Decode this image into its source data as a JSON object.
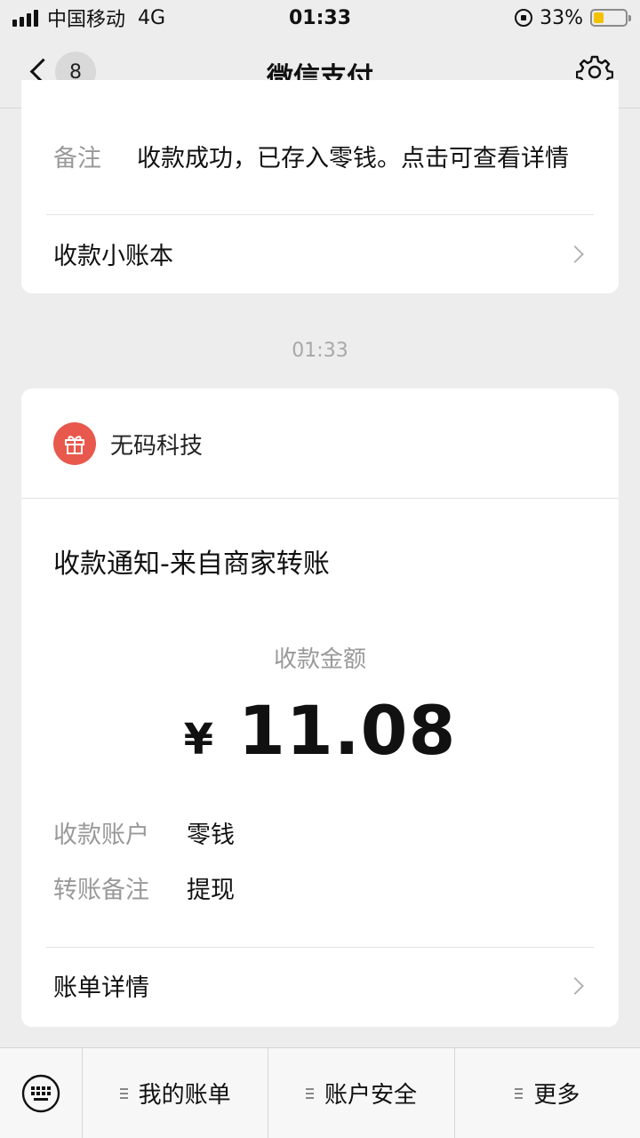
{
  "status_bar": {
    "carrier": "中国移动",
    "network": "4G",
    "time": "01:33",
    "battery": "33%",
    "battery_level": 0.33
  },
  "nav": {
    "badge": "8",
    "title": "微信支付"
  },
  "prev_card": {
    "remark_label": "备注",
    "remark_value": "收款成功，已存入零钱。点击可查看详情",
    "ledger_link": "收款小账本"
  },
  "message_time": "01:33",
  "notice": {
    "merchant": "无码科技",
    "title": "收款通知-来自商家转账",
    "amount_label": "收款金额",
    "currency": "¥",
    "amount": "11.08",
    "account_label": "收款账户",
    "account_value": "零钱",
    "note_label": "转账备注",
    "note_value": "提现",
    "details_link": "账单详情"
  },
  "bottom_menu": {
    "items": [
      "我的账单",
      "账户安全",
      "更多"
    ]
  },
  "colors": {
    "background": "#ededed",
    "merchant_icon": "#e8584c",
    "battery_fill": "#f2c200"
  }
}
